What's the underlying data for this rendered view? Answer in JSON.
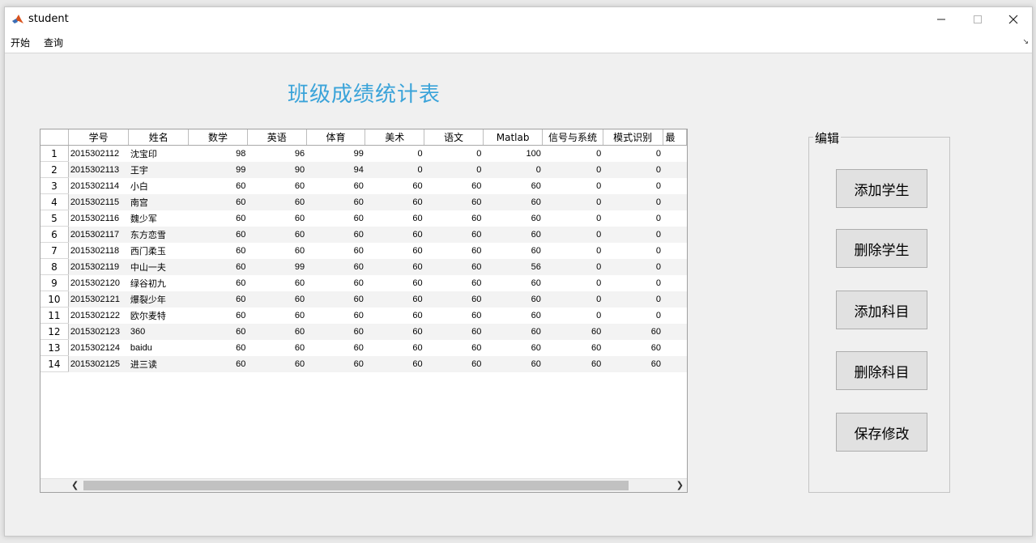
{
  "window": {
    "title": "student"
  },
  "menu": {
    "items": [
      "开始",
      "查询"
    ]
  },
  "page_title": "班级成绩统计表",
  "table": {
    "columns": [
      "学号",
      "姓名",
      "数学",
      "英语",
      "体育",
      "美术",
      "语文",
      "Matlab",
      "信号与系统",
      "模式识别",
      "最"
    ],
    "rows": [
      [
        "1",
        "2015302112",
        "沈宝印",
        "98",
        "96",
        "99",
        "0",
        "0",
        "100",
        "0",
        "0"
      ],
      [
        "2",
        "2015302113",
        "王宇",
        "99",
        "90",
        "94",
        "0",
        "0",
        "0",
        "0",
        "0"
      ],
      [
        "3",
        "2015302114",
        "小白",
        "60",
        "60",
        "60",
        "60",
        "60",
        "60",
        "0",
        "0"
      ],
      [
        "4",
        "2015302115",
        "南宫",
        "60",
        "60",
        "60",
        "60",
        "60",
        "60",
        "0",
        "0"
      ],
      [
        "5",
        "2015302116",
        "魏少军",
        "60",
        "60",
        "60",
        "60",
        "60",
        "60",
        "0",
        "0"
      ],
      [
        "6",
        "2015302117",
        "东方恋雪",
        "60",
        "60",
        "60",
        "60",
        "60",
        "60",
        "0",
        "0"
      ],
      [
        "7",
        "2015302118",
        "西门柔玉",
        "60",
        "60",
        "60",
        "60",
        "60",
        "60",
        "0",
        "0"
      ],
      [
        "8",
        "2015302119",
        "中山一夫",
        "60",
        "99",
        "60",
        "60",
        "60",
        "56",
        "0",
        "0"
      ],
      [
        "9",
        "2015302120",
        "绿谷初九",
        "60",
        "60",
        "60",
        "60",
        "60",
        "60",
        "0",
        "0"
      ],
      [
        "10",
        "2015302121",
        "爆裂少年",
        "60",
        "60",
        "60",
        "60",
        "60",
        "60",
        "0",
        "0"
      ],
      [
        "11",
        "2015302122",
        "欧尔麦特",
        "60",
        "60",
        "60",
        "60",
        "60",
        "60",
        "0",
        "0"
      ],
      [
        "12",
        "2015302123",
        "360",
        "60",
        "60",
        "60",
        "60",
        "60",
        "60",
        "60",
        "60"
      ],
      [
        "13",
        "2015302124",
        "baidu",
        "60",
        "60",
        "60",
        "60",
        "60",
        "60",
        "60",
        "60"
      ],
      [
        "14",
        "2015302125",
        "进三读",
        "60",
        "60",
        "60",
        "60",
        "60",
        "60",
        "60",
        "60"
      ]
    ]
  },
  "panel": {
    "title": "编辑",
    "buttons": [
      "添加学生",
      "删除学生",
      "添加科目",
      "删除科目",
      "保存修改"
    ]
  },
  "icons": {
    "app": "matlab-icon",
    "minimize": "minimize-icon",
    "maximize": "maximize-icon",
    "close": "close-icon",
    "scroll_left": "chevron-left-icon",
    "scroll_right": "chevron-right-icon"
  }
}
